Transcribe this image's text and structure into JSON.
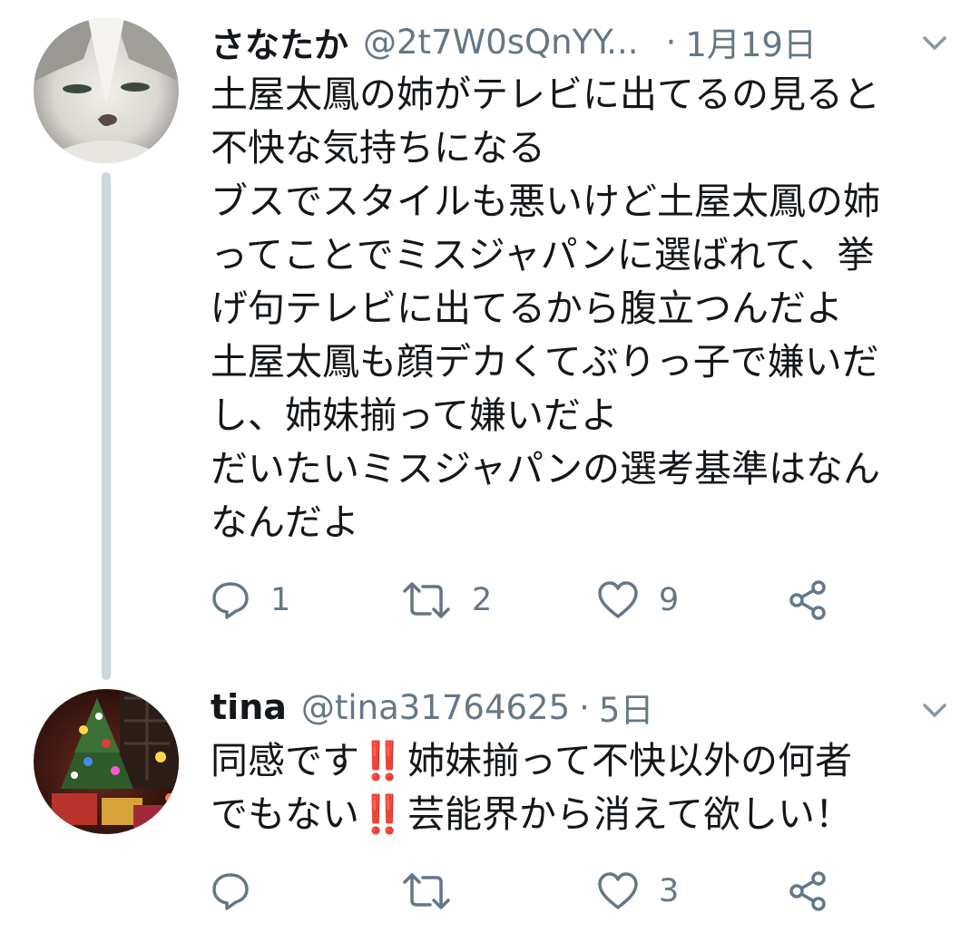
{
  "tweets": [
    {
      "display_name": "さなたか",
      "handle": "@2t7W0sQnYY...",
      "separator": "·",
      "date": "1月19日",
      "body_lines": [
        "土屋太鳳の姉がテレビに出てるの見ると",
        "不快な気持ちになる",
        "ブスでスタイルも悪いけど土屋太鳳の姉",
        "ってことでミスジャパンに選ばれて、挙",
        "げ句テレビに出てるから腹立つんだよ",
        "土屋太鳳も顔デカくてぶりっ子で嫌いだ",
        "し、姉妹揃って嫌いだよ",
        "だいたいミスジャパンの選考基準はなん",
        "なんだよ"
      ],
      "reply_count": "1",
      "retweet_count": "2",
      "like_count": "9",
      "avatar_icon": "cat-avatar"
    },
    {
      "display_name": "tina",
      "handle": "@tina31764625",
      "separator": "·",
      "date": "5日",
      "body": {
        "line1_a": "同感です",
        "line1_b": "姉妹揃って不快以外の何者",
        "line2_a": "でもない",
        "line2_b": "芸能界から消えて欲しい！",
        "emoji": "‼️"
      },
      "reply_count": "",
      "retweet_count": "",
      "like_count": "3",
      "avatar_icon": "christmas-tree-avatar"
    }
  ],
  "colors": {
    "text": "#14171a",
    "secondary": "#657786",
    "thread_line": "#cdd6dd",
    "emoji_red": "#d0262e"
  }
}
